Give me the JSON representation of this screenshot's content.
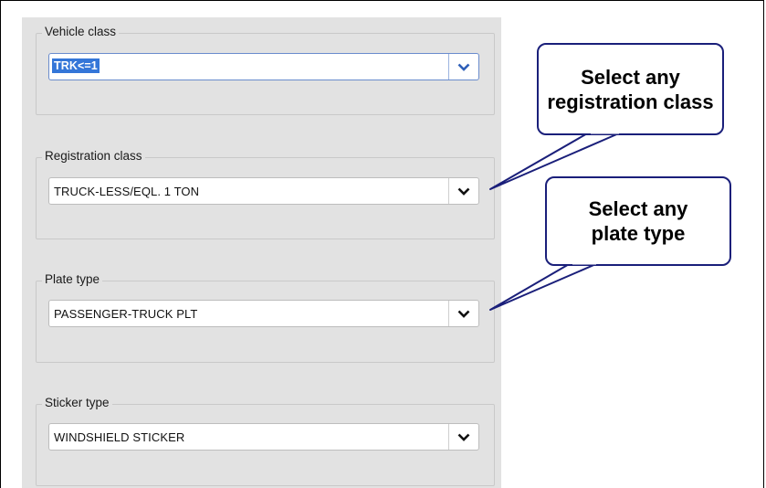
{
  "vehicle_class": {
    "label": "Vehicle class",
    "value": "TRK<=1"
  },
  "registration_class": {
    "label": "Registration class",
    "value": "TRUCK-LESS/EQL. 1 TON"
  },
  "plate_type": {
    "label": "Plate type",
    "value": "PASSENGER-TRUCK PLT"
  },
  "sticker_type": {
    "label": "Sticker type",
    "value": "WINDSHIELD STICKER"
  },
  "callouts": {
    "registration": "Select any registration class",
    "plate": "Select any plate type"
  },
  "colors": {
    "callout_border": "#1a1f7a",
    "selection": "#3476d8",
    "panel": "#e2e2e2"
  },
  "icons": {
    "dropdown": "chevron-down-icon"
  }
}
